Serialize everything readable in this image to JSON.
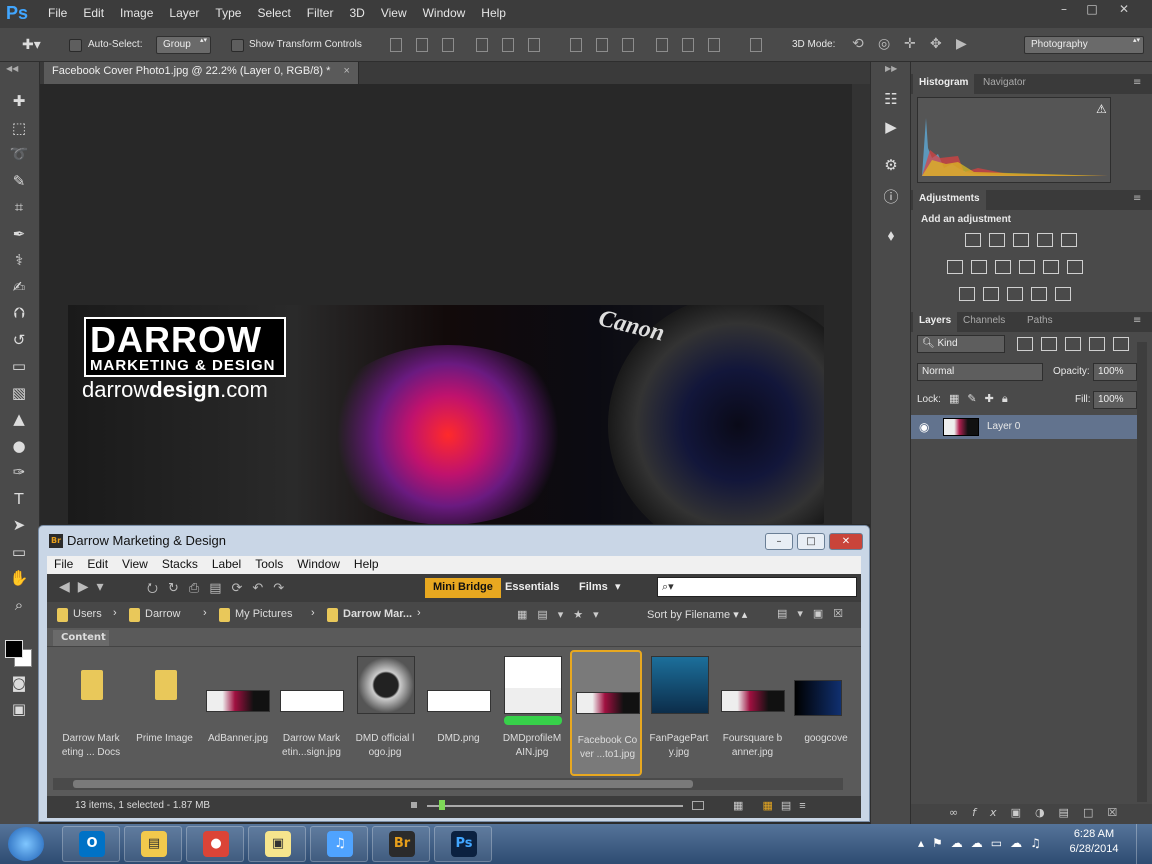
{
  "app": {
    "logo": "Ps",
    "window_controls": [
      "–",
      "□",
      "✕"
    ]
  },
  "menu": [
    "File",
    "Edit",
    "Image",
    "Layer",
    "Type",
    "Select",
    "Filter",
    "3D",
    "View",
    "Window",
    "Help"
  ],
  "options_bar": {
    "auto_select_label": "Auto-Select:",
    "auto_select_value": "Group",
    "show_transform_label": "Show Transform Controls",
    "mode_3d_label": "3D Mode:",
    "workspace": "Photography"
  },
  "document": {
    "tab_title": "Facebook Cover Photo1.jpg @ 22.2% (Layer 0, RGB/8) *",
    "close": "×",
    "logo_line1": "DARROW",
    "logo_line2": "MARKETING & DESIGN",
    "logo_url_plain": "darrow",
    "logo_url_bold": "design",
    "logo_url_tld": ".com",
    "brand": "Canon"
  },
  "panels": {
    "histogram_tabs": [
      "Histogram",
      "Navigator"
    ],
    "adjustments_tab": "Adjustments",
    "add_adjustment": "Add an adjustment",
    "layers_tabs": [
      "Layers",
      "Channels",
      "Paths"
    ],
    "kind_filter": "Kind",
    "blend_mode": "Normal",
    "opacity_label": "Opacity:",
    "opacity_value": "100%",
    "lock_label": "Lock:",
    "fill_label": "Fill:",
    "fill_value": "100%",
    "layer_name": "Layer 0"
  },
  "bridge": {
    "title": "Darrow Marketing & Design",
    "logo": "Br",
    "menu": [
      "File",
      "Edit",
      "View",
      "Stacks",
      "Label",
      "Tools",
      "Window",
      "Help"
    ],
    "workspaces": [
      "Mini Bridge",
      "Essentials",
      "Films"
    ],
    "breadcrumb": [
      "Users",
      "Darrow",
      "My Pictures",
      "Darrow Mar..."
    ],
    "sort": "Sort by Filename",
    "content_tab": "Content",
    "items": [
      {
        "name": "Darrow Marketing ... Docs",
        "line1": "Darrow Mark",
        "line2": "eting ... Docs",
        "kind": "folder"
      },
      {
        "name": "Prime Image",
        "line1": "Prime Image",
        "line2": "",
        "kind": "folder"
      },
      {
        "name": "AdBanner.jpg",
        "line1": "AdBanner.jpg",
        "line2": "",
        "kind": "banner"
      },
      {
        "name": "Darrow Marketin...sign.jpg",
        "line1": "Darrow Mark",
        "line2": "etin...sign.jpg",
        "kind": "logo"
      },
      {
        "name": "DMD official logo.jpg",
        "line1": "DMD official l",
        "line2": "ogo.jpg",
        "kind": "circle"
      },
      {
        "name": "DMD.png",
        "line1": "DMD.png",
        "line2": "",
        "kind": "logo"
      },
      {
        "name": "DMDprofileMAIN.jpg",
        "line1": "DMDprofileM",
        "line2": "AIN.jpg",
        "kind": "profile"
      },
      {
        "name": "Facebook Cover ...to1.jpg",
        "line1": "Facebook Co",
        "line2": "ver ...to1.jpg",
        "kind": "banner"
      },
      {
        "name": "FanPageParty.jpg",
        "line1": "FanPagePart",
        "line2": "y.jpg",
        "kind": "poster"
      },
      {
        "name": "Foursquare banner.jpg",
        "line1": "Foursquare b",
        "line2": "anner.jpg",
        "kind": "banner"
      },
      {
        "name": "googcove",
        "line1": "googcove",
        "line2": "",
        "kind": "dark"
      }
    ],
    "status": "13 items, 1 selected - 1.87 MB"
  },
  "taskbar": {
    "apps": [
      "Outlook",
      "Explorer",
      "Chrome",
      "Sticky Notes",
      "iTunes",
      "Bridge",
      "Photoshop"
    ],
    "time": "6:28 AM",
    "date": "6/28/2014"
  },
  "colors": {
    "accent": "#41a6ff",
    "bridge_accent": "#e8a820",
    "selected_layer": "#62738e"
  }
}
